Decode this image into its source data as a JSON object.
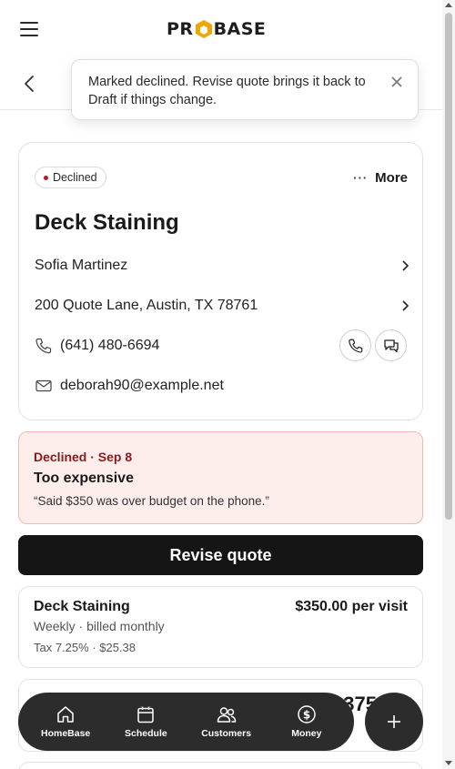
{
  "header": {
    "logo": {
      "left": "PR",
      "right": "BASE",
      "hex_color": "#f0a500"
    }
  },
  "toast": {
    "message": "Marked declined. Revise quote brings it back to Draft if things change."
  },
  "quote": {
    "status": "Declined",
    "status_color": "#c3161c",
    "more_label": "More",
    "title": "Deck Staining",
    "customer": "Sofia Martinez",
    "address": "200 Quote Lane, Austin, TX 78761",
    "phone": "(641) 480-6694",
    "email": "deborah90@example.net"
  },
  "declined_panel": {
    "header": "Declined · Sep 8",
    "reason": "Too expensive",
    "note": "“Said $350 was over budget on the phone.”"
  },
  "revise_button": {
    "label": "Revise quote"
  },
  "line_items": [
    {
      "name": "Deck Staining",
      "price": "$350.00 per visit",
      "schedule": "Weekly · billed monthly",
      "tax": "Tax 7.25% · $25.38"
    },
    {
      "price_partial": "$375"
    }
  ],
  "bottom_nav": {
    "items": [
      {
        "label": "HomeBase",
        "icon": "home-icon"
      },
      {
        "label": "Schedule",
        "icon": "calendar-icon"
      },
      {
        "label": "Customers",
        "icon": "users-icon"
      },
      {
        "label": "Money",
        "icon": "dollar-icon"
      }
    ],
    "fab_icon": "plus-icon"
  }
}
